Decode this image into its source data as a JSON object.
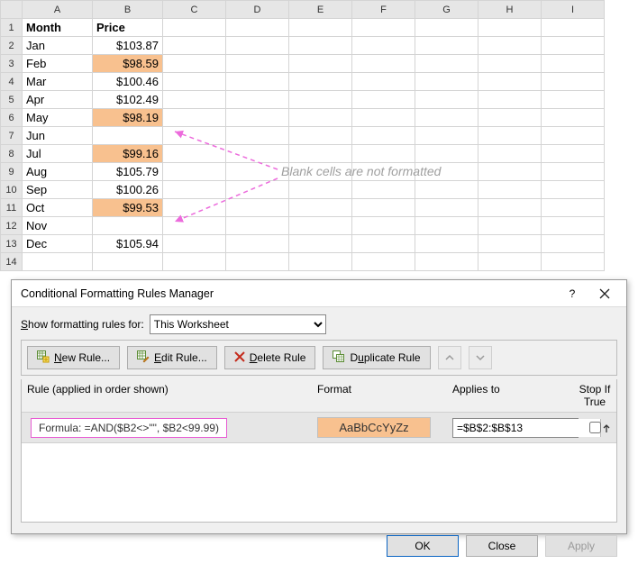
{
  "grid": {
    "columns": [
      "A",
      "B",
      "C",
      "D",
      "E",
      "F",
      "G",
      "H",
      "I"
    ],
    "headers": {
      "A": "Month",
      "B": "Price"
    },
    "rows": [
      {
        "n": "1"
      },
      {
        "n": "2",
        "month": "Jan",
        "price": "$103.87",
        "hl": false
      },
      {
        "n": "3",
        "month": "Feb",
        "price": "$98.59",
        "hl": true
      },
      {
        "n": "4",
        "month": "Mar",
        "price": "$100.46",
        "hl": false
      },
      {
        "n": "5",
        "month": "Apr",
        "price": "$102.49",
        "hl": false
      },
      {
        "n": "6",
        "month": "May",
        "price": "$98.19",
        "hl": true
      },
      {
        "n": "7",
        "month": "Jun",
        "price": "",
        "hl": false
      },
      {
        "n": "8",
        "month": "Jul",
        "price": "$99.16",
        "hl": true
      },
      {
        "n": "9",
        "month": "Aug",
        "price": "$105.79",
        "hl": false
      },
      {
        "n": "10",
        "month": "Sep",
        "price": "$100.26",
        "hl": false
      },
      {
        "n": "11",
        "month": "Oct",
        "price": "$99.53",
        "hl": true
      },
      {
        "n": "12",
        "month": "Nov",
        "price": "",
        "hl": false
      },
      {
        "n": "13",
        "month": "Dec",
        "price": "$105.94",
        "hl": false
      },
      {
        "n": "14"
      }
    ]
  },
  "annotation": "Blank cells are not formatted",
  "dialog": {
    "title": "Conditional Formatting Rules Manager",
    "show_label_pre": "S",
    "show_label_mid": "how formatting rules for:",
    "scope": "This Worksheet",
    "buttons": {
      "new": "New Rule...",
      "edit": "Edit Rule...",
      "delete": "Delete Rule",
      "duplicate": "Duplicate Rule"
    },
    "cols": {
      "rule": "Rule (applied in order shown)",
      "format": "Format",
      "applies": "Applies to",
      "stop": "Stop If True"
    },
    "rule": {
      "formula": "Formula: =AND($B2<>\"\", $B2<99.99)",
      "sample": "AaBbCcYyZz",
      "applies": "=$B$2:$B$13"
    },
    "footer": {
      "ok": "OK",
      "close": "Close",
      "apply": "Apply"
    }
  }
}
